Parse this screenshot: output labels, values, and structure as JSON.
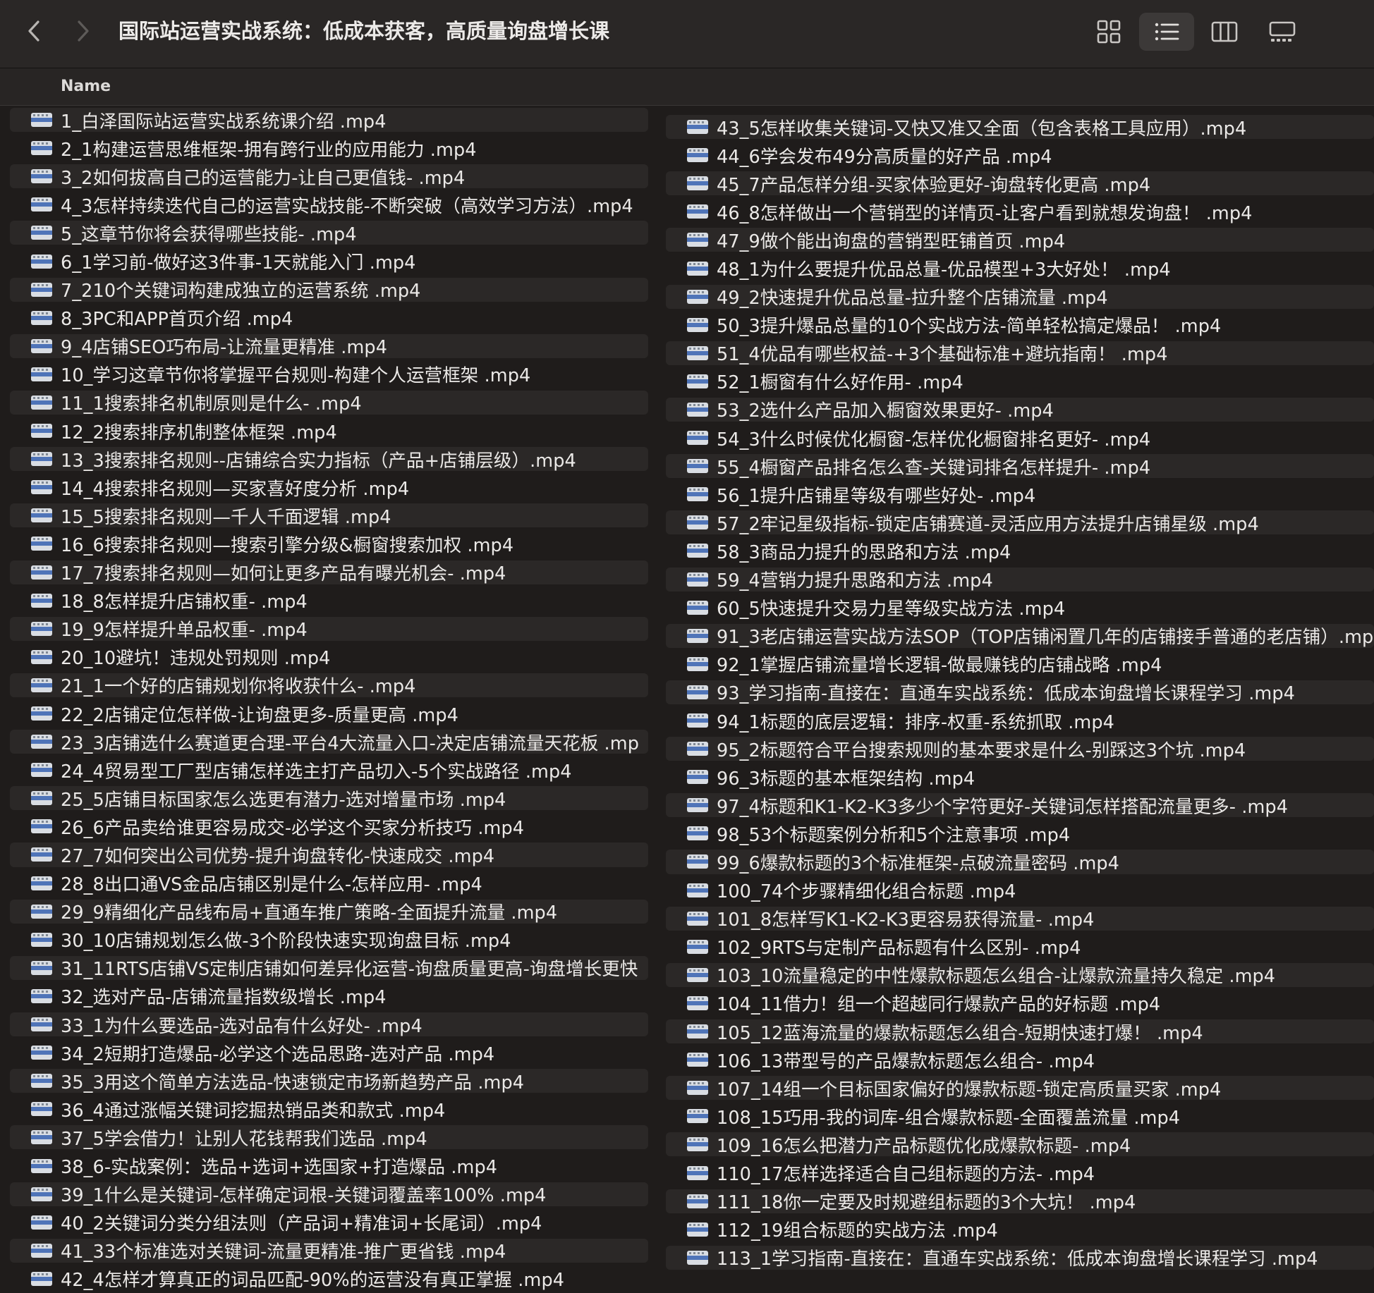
{
  "window": {
    "title": "国际站运营实战系统：低成本获客，高质量询盘增长课"
  },
  "toolbar": {
    "back_icon": "chevron-left-icon",
    "forward_icon": "chevron-right-icon",
    "view_modes": [
      "icon-view-icon",
      "list-view-icon",
      "column-view-icon",
      "gallery-view-icon"
    ],
    "active_view": "list-view-icon"
  },
  "list_header": {
    "name_column": "Name"
  },
  "files_left": [
    "1_白泽国际站运营实战系统课介绍 .mp4",
    "2_1构建运营思维框架-拥有跨行业的应用能力 .mp4",
    "3_2如何拔高自己的运营能力-让自己更值钱- .mp4",
    "4_3怎样持续迭代自己的运营实战技能-不断突破（高效学习方法）.mp4",
    "5_这章节你将会获得哪些技能- .mp4",
    "6_1学习前-做好这3件事-1天就能入门 .mp4",
    "7_210个关键词构建成独立的运营系统 .mp4",
    "8_3PC和APP首页介绍 .mp4",
    "9_4店铺SEO巧布局-让流量更精准 .mp4",
    "10_学习这章节你将掌握平台规则-构建个人运营框架 .mp4",
    "11_1搜索排名机制原则是什么- .mp4",
    "12_2搜索排序机制整体框架 .mp4",
    "13_3搜索排名规则--店铺综合实力指标（产品+店铺层级）.mp4",
    "14_4搜索排名规则—买家喜好度分析 .mp4",
    "15_5搜索排名规则—千人千面逻辑 .mp4",
    "16_6搜索排名规则—搜索引擎分级&橱窗搜索加权 .mp4",
    "17_7搜索排名规则—如何让更多产品有曝光机会- .mp4",
    "18_8怎样提升店铺权重- .mp4",
    "19_9怎样提升单品权重- .mp4",
    "20_10避坑！违规处罚规则 .mp4",
    "21_1一个好的店铺规划你将收获什么- .mp4",
    "22_2店铺定位怎样做-让询盘更多-质量更高 .mp4",
    "23_3店铺选什么赛道更合理-平台4大流量入口-决定店铺流量天花板 .mp",
    "24_4贸易型工厂型店铺怎样选主打产品切入-5个实战路径 .mp4",
    "25_5店铺目标国家怎么选更有潜力-选对增量市场 .mp4",
    "26_6产品卖给谁更容易成交-必学这个买家分析技巧 .mp4",
    "27_7如何突出公司优势-提升询盘转化-快速成交 .mp4",
    "28_8出口通VS金品店铺区别是什么-怎样应用- .mp4",
    "29_9精细化产品线布局+直通车推广策略-全面提升流量 .mp4",
    "30_10店铺规划怎么做-3个阶段快速实现询盘目标 .mp4",
    "31_11RTS店铺VS定制店铺如何差异化运营-询盘质量更高-询盘增长更快",
    "32_选对产品-店铺流量指数级增长 .mp4",
    "33_1为什么要选品-选对品有什么好处- .mp4",
    "34_2短期打造爆品-必学这个选品思路-选对产品 .mp4",
    "35_3用这个简单方法选品-快速锁定市场新趋势产品 .mp4",
    "36_4通过涨幅关键词挖掘热销品类和款式 .mp4",
    "37_5学会借力！让别人花钱帮我们选品 .mp4",
    "38_6-实战案例：选品+选词+选国家+打造爆品 .mp4",
    "39_1什么是关键词-怎样确定词根-关键词覆盖率100% .mp4",
    "40_2关键词分类分组法则（产品词+精准词+长尾词）.mp4",
    "41_33个标准选对关键词-流量更精准-推广更省钱 .mp4",
    "42_4怎样才算真正的词品匹配-90%的运营没有真正掌握 .mp4"
  ],
  "files_right": [
    "43_5怎样收集关键词-又快又准又全面（包含表格工具应用）.mp4",
    "44_6学会发布49分高质量的好产品 .mp4",
    "45_7产品怎样分组-买家体验更好-询盘转化更高 .mp4",
    "46_8怎样做出一个营销型的详情页-让客户看到就想发询盘！ .mp4",
    "47_9做个能出询盘的营销型旺铺首页 .mp4",
    "48_1为什么要提升优品总量-优品模型+3大好处！ .mp4",
    "49_2快速提升优品总量-拉升整个店铺流量 .mp4",
    "50_3提升爆品总量的10个实战方法-简单轻松搞定爆品！ .mp4",
    "51_4优品有哪些权益-+3个基础标准+避坑指南！ .mp4",
    "52_1橱窗有什么好作用- .mp4",
    "53_2选什么产品加入橱窗效果更好- .mp4",
    "54_3什么时候优化橱窗-怎样优化橱窗排名更好- .mp4",
    "55_4橱窗产品排名怎么查-关键词排名怎样提升- .mp4",
    "56_1提升店铺星等级有哪些好处- .mp4",
    "57_2牢记星级指标-锁定店铺赛道-灵活应用方法提升店铺星级 .mp4",
    "58_3商品力提升的思路和方法 .mp4",
    "59_4营销力提升思路和方法 .mp4",
    "60_5快速提升交易力星等级实战方法 .mp4",
    "91_3老店铺运营实战方法SOP（TOP店铺闲置几年的店铺接手普通的老店铺）.mp4",
    "92_1掌握店铺流量增长逻辑-做最赚钱的店铺战略 .mp4",
    "93_学习指南-直接在：直通车实战系统：低成本询盘增长课程学习 .mp4",
    "94_1标题的底层逻辑：排序-权重-系统抓取 .mp4",
    "95_2标题符合平台搜索规则的基本要求是什么-别踩这3个坑 .mp4",
    "96_3标题的基本框架结构 .mp4",
    "97_4标题和K1-K2-K3多少个字符更好-关键词怎样搭配流量更多- .mp4",
    "98_53个标题案例分析和5个注意事项 .mp4",
    "99_6爆款标题的3个标准框架-点破流量密码 .mp4",
    "100_74个步骤精细化组合标题 .mp4",
    "101_8怎样写K1-K2-K3更容易获得流量- .mp4",
    "102_9RTS与定制产品标题有什么区别- .mp4",
    "103_10流量稳定的中性爆款标题怎么组合-让爆款流量持久稳定 .mp4",
    "104_11借力！组一个超越同行爆款产品的好标题 .mp4",
    "105_12蓝海流量的爆款标题怎么组合-短期快速打爆！ .mp4",
    "106_13带型号的产品爆款标题怎么组合- .mp4",
    "107_14组一个目标国家偏好的爆款标题-锁定高质量买家 .mp4",
    "108_15巧用-我的词库-组合爆款标题-全面覆盖流量 .mp4",
    "109_16怎么把潜力产品标题优化成爆款标题- .mp4",
    "110_17怎样选择适合自己组标题的方法- .mp4",
    "111_18你一定要及时规避组标题的3个大坑！ .mp4",
    "112_19组合标题的实战方法 .mp4",
    "113_1学习指南-直接在：直通车实战系统：低成本询盘增长课程学习 .mp4"
  ]
}
